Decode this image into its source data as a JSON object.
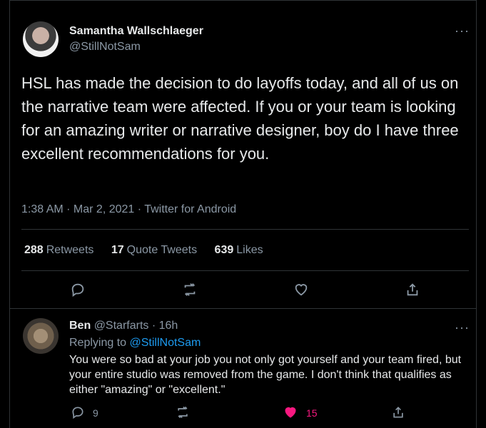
{
  "tweet": {
    "author_name": "Samantha Wallschlaeger",
    "author_handle": "@StillNotSam",
    "text": "HSL has made the decision to do layoffs today, and all of us on the narrative team were affected. If you or your team is looking for an amazing writer or narrative designer, boy do I have three excellent recommendations for you.",
    "meta": "1:38 AM · Mar 2, 2021 · Twitter for Android",
    "stats": {
      "retweets_count": "288",
      "retweets_label": "Retweets",
      "quote_count": "17",
      "quote_label": "Quote Tweets",
      "likes_count": "639",
      "likes_label": "Likes"
    }
  },
  "reply": {
    "author_name": "Ben",
    "author_handle": "@Starfarts",
    "time": "· 16h",
    "replying_prefix": "Replying to",
    "replying_handle": "@StillNotSam",
    "text": "You were so bad at your job you not only got yourself and your team fired, but your entire studio was removed from the game. I don't think that qualifies as either \"amazing\" or \"excellent.\"",
    "reply_count": "9",
    "like_count": "15"
  },
  "more_glyph": "···",
  "colors": {
    "background": "#000000",
    "accent": "#1d9bf0",
    "like": "#f91880",
    "muted": "#8b98a5"
  }
}
